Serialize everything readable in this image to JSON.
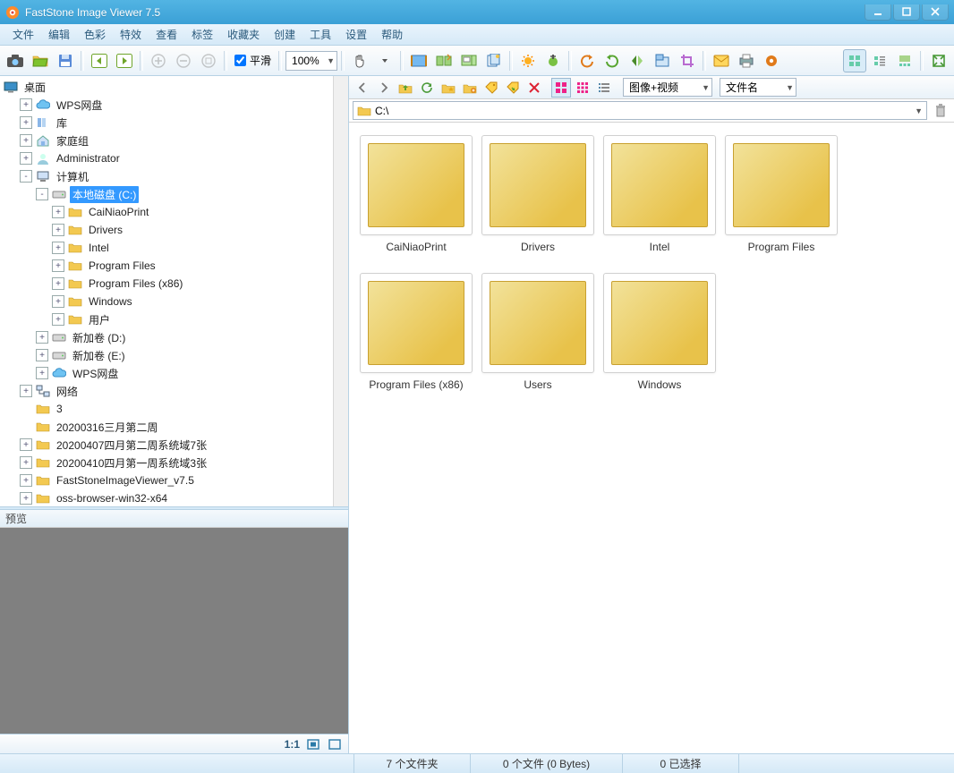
{
  "titlebar": {
    "title": "FastStone Image Viewer 7.5"
  },
  "menu": {
    "file": "文件",
    "edit": "编辑",
    "color": "色彩",
    "effect": "特效",
    "view": "查看",
    "tag": "标签",
    "fav": "收藏夹",
    "create": "创建",
    "tools": "工具",
    "settings": "设置",
    "help": "帮助"
  },
  "toolbar": {
    "smooth_label": "平滑",
    "zoom": "100%"
  },
  "tree": {
    "root": "桌面",
    "items": [
      {
        "exp": "+",
        "icon": "cloud",
        "label": "WPS网盘"
      },
      {
        "exp": "+",
        "icon": "lib",
        "label": "库"
      },
      {
        "exp": "+",
        "icon": "home",
        "label": "家庭组"
      },
      {
        "exp": "+",
        "icon": "user",
        "label": "Administrator"
      },
      {
        "exp": "-",
        "icon": "computer",
        "label": "计算机",
        "children": [
          {
            "exp": "-",
            "icon": "drive",
            "label": "本地磁盘 (C:)",
            "selected": true,
            "children": [
              {
                "exp": "+",
                "icon": "folder",
                "label": "CaiNiaoPrint"
              },
              {
                "exp": "+",
                "icon": "folder",
                "label": "Drivers"
              },
              {
                "exp": "+",
                "icon": "folder",
                "label": "Intel"
              },
              {
                "exp": "+",
                "icon": "folder",
                "label": "Program Files"
              },
              {
                "exp": "+",
                "icon": "folder",
                "label": "Program Files (x86)"
              },
              {
                "exp": "+",
                "icon": "folder",
                "label": "Windows"
              },
              {
                "exp": "+",
                "icon": "folder",
                "label": "用户"
              }
            ]
          },
          {
            "exp": "+",
            "icon": "drive",
            "label": "新加卷 (D:)"
          },
          {
            "exp": "+",
            "icon": "drive",
            "label": "新加卷 (E:)"
          },
          {
            "exp": "+",
            "icon": "cloud",
            "label": "WPS网盘"
          }
        ]
      },
      {
        "exp": "+",
        "icon": "network",
        "label": "网络"
      },
      {
        "exp": "",
        "icon": "folder",
        "label": "3"
      },
      {
        "exp": "",
        "icon": "folder",
        "label": "20200316三月第二周"
      },
      {
        "exp": "+",
        "icon": "folder",
        "label": "20200407四月第二周系统域7张"
      },
      {
        "exp": "+",
        "icon": "folder",
        "label": "20200410四月第一周系统域3张"
      },
      {
        "exp": "+",
        "icon": "folder",
        "label": "FastStoneImageViewer_v7.5"
      },
      {
        "exp": "+",
        "icon": "folder",
        "label": "oss-browser-win32-x64"
      }
    ]
  },
  "preview": {
    "title": "预览",
    "ratio": "1:1"
  },
  "browse": {
    "filter1": "图像+视频",
    "filter2": "文件名",
    "path": "C:\\"
  },
  "files": [
    {
      "name": "CaiNiaoPrint"
    },
    {
      "name": "Drivers"
    },
    {
      "name": "Intel"
    },
    {
      "name": "Program Files"
    },
    {
      "name": "Program Files (x86)"
    },
    {
      "name": "Users"
    },
    {
      "name": "Windows"
    }
  ],
  "status": {
    "folders": "7 个文件夹",
    "files": "0 个文件 (0 Bytes)",
    "selected": "0 已选择"
  }
}
